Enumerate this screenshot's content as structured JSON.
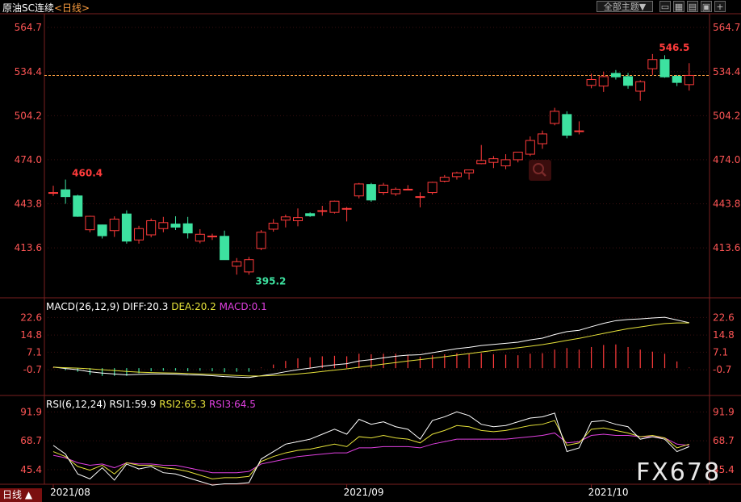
{
  "header": {
    "title": "原油SC连续",
    "period_link": "<日线>",
    "theme_button": "全部主题▼",
    "icon_buttons": [
      "minimize-icon",
      "calendar-icon",
      "grid-icon",
      "lock-icon",
      "add-icon"
    ]
  },
  "colors": {
    "background": "#000000",
    "up": "#ff3b3b",
    "down": "#3de2a0",
    "grid": "#7a1f1f",
    "axis_text": "#ff5555",
    "white_line": "#ffffff",
    "yellow_line": "#e6e23a",
    "magenta_line": "#e040e0",
    "last_price_line": "#ff9f40"
  },
  "period_button": "日线 ▲",
  "watermark": "FX678",
  "chart_data": [
    {
      "type": "candlestick",
      "title": "原油SC连续",
      "y_ticks": [
        564.7,
        534.4,
        504.2,
        474.0,
        443.8,
        413.6
      ],
      "y_tick_labels": [
        "564.7",
        "534.4",
        "504.2",
        "474.0",
        "443.8",
        "413.6"
      ],
      "ylim": [
        381.0,
        573.0
      ],
      "x_labels": [
        {
          "index": 0,
          "label": "2021/08"
        },
        {
          "index": 24,
          "label": "2021/09"
        },
        {
          "index": 44,
          "label": "2021/10"
        }
      ],
      "annotations": [
        {
          "label": "460.4",
          "index": 1,
          "value": 460.4
        },
        {
          "label": "395.2",
          "index": 16,
          "value": 395.2
        },
        {
          "label": "546.5",
          "index": 49,
          "value": 546.5
        }
      ],
      "last_price": 531.8,
      "candles": [
        {
          "o": 451.5,
          "h": 456.2,
          "l": 449.2,
          "c": 451.5
        },
        {
          "o": 453.4,
          "h": 460.4,
          "l": 443.8,
          "c": 448.7
        },
        {
          "o": 449.2,
          "h": 450.0,
          "l": 434.8,
          "c": 435.2
        },
        {
          "o": 426.0,
          "h": 435.6,
          "l": 424.3,
          "c": 435.2
        },
        {
          "o": 429.3,
          "h": 429.5,
          "l": 420.0,
          "c": 421.9
        },
        {
          "o": 425.4,
          "h": 435.2,
          "l": 421.1,
          "c": 433.3
        },
        {
          "o": 436.8,
          "h": 439.3,
          "l": 416.5,
          "c": 418.2
        },
        {
          "o": 419.0,
          "h": 428.7,
          "l": 416.5,
          "c": 426.8
        },
        {
          "o": 422.5,
          "h": 433.7,
          "l": 420.8,
          "c": 432.2
        },
        {
          "o": 426.8,
          "h": 434.8,
          "l": 424.3,
          "c": 430.9
        },
        {
          "o": 429.9,
          "h": 435.2,
          "l": 425.8,
          "c": 427.8
        },
        {
          "o": 430.1,
          "h": 434.8,
          "l": 420.0,
          "c": 423.8
        },
        {
          "o": 418.2,
          "h": 426.4,
          "l": 416.7,
          "c": 422.9
        },
        {
          "o": 421.1,
          "h": 423.3,
          "l": 419.0,
          "c": 421.7
        },
        {
          "o": 421.5,
          "h": 425.4,
          "l": 405.5,
          "c": 405.5
        },
        {
          "o": 401.0,
          "h": 406.6,
          "l": 395.2,
          "c": 404.1
        },
        {
          "o": 397.1,
          "h": 407.4,
          "l": 395.2,
          "c": 405.5
        },
        {
          "o": 413.2,
          "h": 425.8,
          "l": 412.0,
          "c": 424.3
        },
        {
          "o": 426.4,
          "h": 433.3,
          "l": 424.7,
          "c": 430.5
        },
        {
          "o": 432.6,
          "h": 436.4,
          "l": 427.6,
          "c": 434.8
        },
        {
          "o": 432.2,
          "h": 440.6,
          "l": 428.4,
          "c": 434.3
        },
        {
          "o": 437.0,
          "h": 437.9,
          "l": 434.8,
          "c": 435.6
        },
        {
          "o": 438.9,
          "h": 442.4,
          "l": 435.6,
          "c": 439.1
        },
        {
          "o": 437.9,
          "h": 446.0,
          "l": 437.1,
          "c": 445.6
        },
        {
          "o": 440.6,
          "h": 441.6,
          "l": 431.7,
          "c": 440.6
        },
        {
          "o": 449.2,
          "h": 458.1,
          "l": 447.5,
          "c": 457.4
        },
        {
          "o": 457.0,
          "h": 458.1,
          "l": 445.2,
          "c": 446.4
        },
        {
          "o": 451.5,
          "h": 458.1,
          "l": 449.9,
          "c": 456.6
        },
        {
          "o": 450.7,
          "h": 455.0,
          "l": 449.2,
          "c": 453.8
        },
        {
          "o": 453.8,
          "h": 456.6,
          "l": 453.1,
          "c": 453.8
        },
        {
          "o": 448.7,
          "h": 451.7,
          "l": 441.4,
          "c": 448.7
        },
        {
          "o": 451.5,
          "h": 458.9,
          "l": 450.2,
          "c": 458.5
        },
        {
          "o": 459.3,
          "h": 463.5,
          "l": 458.5,
          "c": 462.0
        },
        {
          "o": 462.4,
          "h": 465.8,
          "l": 460.4,
          "c": 465.0
        },
        {
          "o": 465.0,
          "h": 467.0,
          "l": 460.4,
          "c": 467.0
        },
        {
          "o": 471.3,
          "h": 484.1,
          "l": 470.9,
          "c": 473.5
        },
        {
          "o": 472.2,
          "h": 476.5,
          "l": 468.3,
          "c": 474.7
        },
        {
          "o": 469.8,
          "h": 477.8,
          "l": 467.5,
          "c": 474.0
        },
        {
          "o": 474.0,
          "h": 479.2,
          "l": 472.2,
          "c": 479.2
        },
        {
          "o": 477.8,
          "h": 490.0,
          "l": 476.5,
          "c": 487.2
        },
        {
          "o": 485.0,
          "h": 494.0,
          "l": 481.5,
          "c": 491.7
        },
        {
          "o": 498.9,
          "h": 509.6,
          "l": 497.6,
          "c": 507.2
        },
        {
          "o": 505.0,
          "h": 507.2,
          "l": 488.7,
          "c": 490.8
        },
        {
          "o": 493.8,
          "h": 500.3,
          "l": 491.4,
          "c": 493.8
        },
        {
          "o": 525.0,
          "h": 533.0,
          "l": 523.0,
          "c": 529.0
        },
        {
          "o": 524.5,
          "h": 534.4,
          "l": 520.5,
          "c": 531.0
        },
        {
          "o": 533.2,
          "h": 535.5,
          "l": 529.0,
          "c": 530.8
        },
        {
          "o": 531.0,
          "h": 533.5,
          "l": 522.7,
          "c": 525.0
        },
        {
          "o": 521.0,
          "h": 528.5,
          "l": 514.5,
          "c": 527.5
        },
        {
          "o": 536.4,
          "h": 546.5,
          "l": 532.1,
          "c": 542.7
        },
        {
          "o": 542.7,
          "h": 545.7,
          "l": 530.2,
          "c": 530.8
        },
        {
          "o": 531.2,
          "h": 532.1,
          "l": 524.5,
          "c": 527.0
        },
        {
          "o": 525.5,
          "h": 540.2,
          "l": 521.4,
          "c": 531.8
        }
      ]
    },
    {
      "type": "bar",
      "title": "MACD(26,12,9)",
      "legend": [
        {
          "name": "DIFF",
          "value": "20.3",
          "color": "#ffffff"
        },
        {
          "name": "DEA",
          "value": "20.2",
          "color": "#e6e23a"
        },
        {
          "name": "MACD",
          "value": "0.1",
          "color": "#e040e0"
        }
      ],
      "y_ticks": [
        22.6,
        14.8,
        7.1,
        -0.7
      ],
      "y_tick_labels": [
        "22.6",
        "14.8",
        "7.1",
        "-0.7"
      ],
      "ylim": [
        -5.0,
        26.0
      ],
      "diff": [
        0.5,
        -0.2,
        -0.7,
        -1.6,
        -2.2,
        -2.6,
        -3.0,
        -2.8,
        -2.6,
        -2.6,
        -2.7,
        -3.0,
        -3.1,
        -3.4,
        -3.8,
        -4.0,
        -4.2,
        -3.4,
        -2.6,
        -1.6,
        -0.7,
        0.0,
        0.8,
        1.5,
        2.0,
        3.2,
        3.8,
        4.6,
        5.3,
        5.8,
        6.0,
        6.9,
        7.8,
        8.7,
        9.3,
        10.1,
        10.6,
        11.1,
        11.6,
        12.6,
        13.4,
        15.0,
        16.3,
        16.9,
        18.5,
        20.0,
        21.2,
        21.7,
        22.0,
        22.4,
        22.7,
        21.5,
        20.3
      ],
      "dea": [
        0.4,
        0.2,
        0.0,
        -0.3,
        -0.7,
        -1.1,
        -1.5,
        -1.8,
        -2.0,
        -2.1,
        -2.2,
        -2.4,
        -2.6,
        -2.8,
        -3.0,
        -3.3,
        -3.5,
        -3.5,
        -3.3,
        -3.0,
        -2.6,
        -2.1,
        -1.5,
        -0.9,
        -0.3,
        0.4,
        1.1,
        1.8,
        2.5,
        3.2,
        3.8,
        4.4,
        5.1,
        5.8,
        6.5,
        7.2,
        7.9,
        8.5,
        9.1,
        9.8,
        10.5,
        11.4,
        12.4,
        13.3,
        14.4,
        15.5,
        16.6,
        17.6,
        18.4,
        19.2,
        19.9,
        20.2,
        20.2
      ],
      "macd": [
        0.1,
        -0.4,
        -0.7,
        -1.3,
        -1.5,
        -1.5,
        -1.5,
        -1.0,
        -0.6,
        -0.5,
        -0.5,
        -0.6,
        -0.5,
        -0.6,
        -0.8,
        -0.7,
        -0.7,
        0.1,
        0.7,
        1.4,
        1.9,
        2.1,
        2.3,
        2.4,
        2.3,
        2.8,
        2.7,
        2.8,
        2.8,
        2.6,
        2.2,
        2.5,
        2.7,
        2.9,
        2.8,
        2.9,
        2.7,
        2.6,
        2.5,
        2.8,
        2.9,
        3.6,
        3.9,
        3.6,
        4.1,
        4.5,
        4.6,
        4.1,
        3.6,
        3.2,
        2.8,
        1.3,
        0.1
      ]
    },
    {
      "type": "line",
      "title": "RSI(6,12,24)",
      "legend": [
        {
          "name": "RSI1",
          "value": "59.9",
          "color": "#ffffff"
        },
        {
          "name": "RSI2",
          "value": "65.3",
          "color": "#e6e23a"
        },
        {
          "name": "RSI3",
          "value": "64.5",
          "color": "#e040e0"
        }
      ],
      "y_ticks": [
        91.9,
        68.7,
        45.4
      ],
      "y_tick_labels": [
        "91.9",
        "68.7",
        "45.4"
      ],
      "ylim": [
        35.0,
        100.0
      ],
      "rsi1": [
        65,
        58,
        42,
        38,
        47,
        37,
        50,
        46,
        48,
        43,
        42,
        39,
        36,
        33,
        34,
        34,
        35,
        54,
        60,
        66,
        68,
        70,
        74,
        78,
        74,
        86,
        82,
        84,
        80,
        78,
        70,
        85,
        88,
        92,
        89,
        82,
        80,
        81,
        84,
        87,
        88,
        91,
        60,
        63,
        84,
        85,
        82,
        80,
        70,
        72,
        70,
        60,
        64
      ],
      "rsi2": [
        60,
        56,
        48,
        45,
        49,
        42,
        51,
        49,
        49,
        47,
        46,
        44,
        41,
        38,
        39,
        39,
        40,
        52,
        56,
        59,
        61,
        62,
        64,
        66,
        64,
        72,
        71,
        73,
        71,
        70,
        67,
        74,
        77,
        81,
        80,
        77,
        76,
        77,
        79,
        81,
        82,
        85,
        65,
        67,
        78,
        79,
        77,
        75,
        72,
        73,
        71,
        63,
        66
      ],
      "rsi3": [
        57,
        55,
        51,
        49,
        50,
        47,
        51,
        50,
        50,
        49,
        49,
        47,
        45,
        43,
        43,
        43,
        44,
        50,
        52,
        54,
        56,
        57,
        58,
        59,
        59,
        63,
        63,
        64,
        64,
        64,
        63,
        66,
        68,
        70,
        70,
        70,
        70,
        70,
        71,
        72,
        73,
        75,
        67,
        68,
        73,
        74,
        73,
        73,
        72,
        72,
        71,
        66,
        65
      ]
    }
  ]
}
